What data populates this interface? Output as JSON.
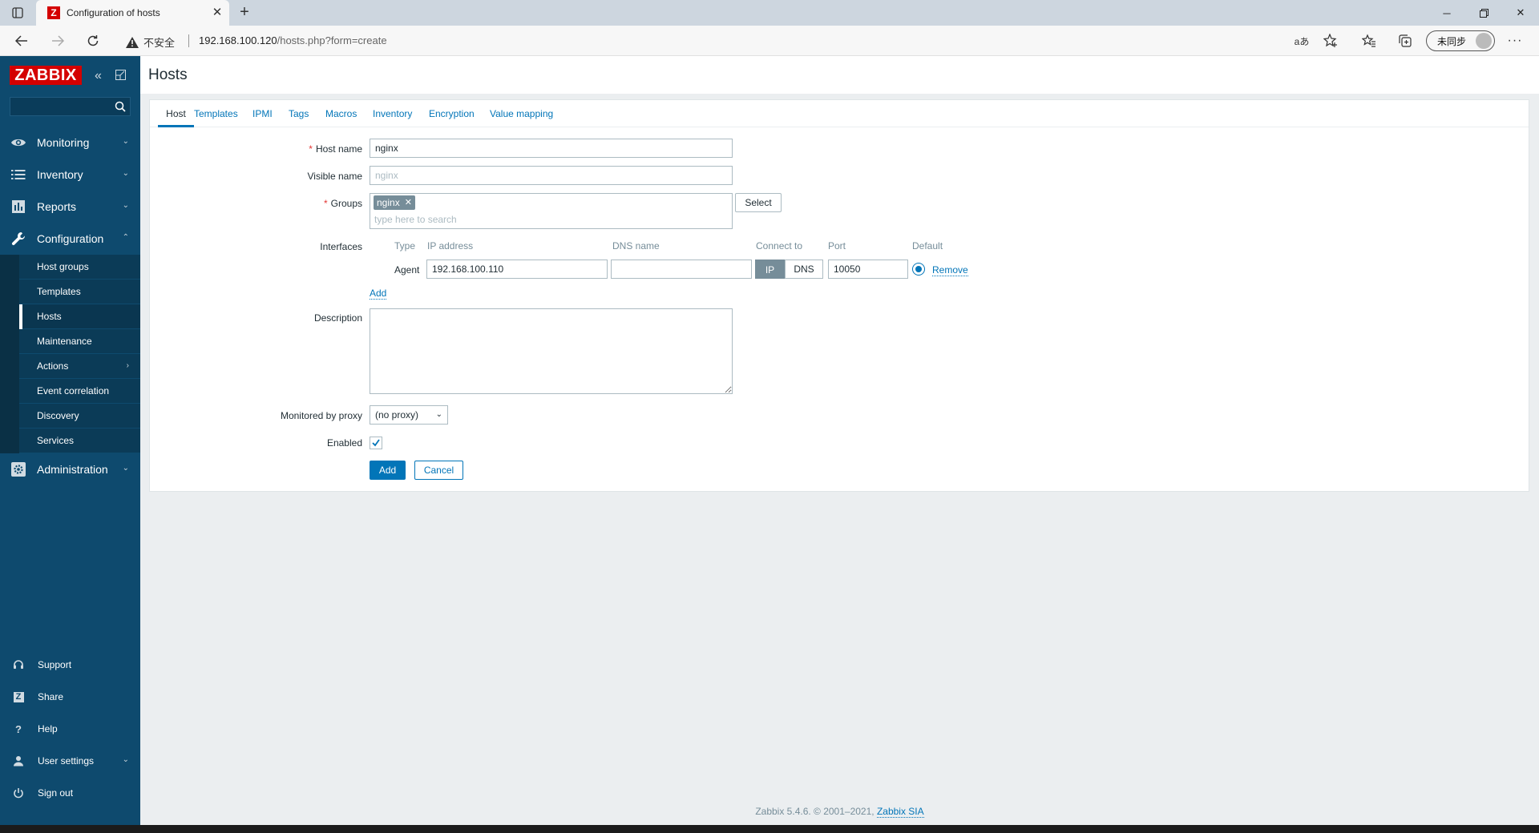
{
  "browser": {
    "tab_title": "Configuration of hosts",
    "tab_favicon": "Z",
    "security_label": "不安全",
    "url_host": "192.168.100.120",
    "url_path": "/hosts.php?form=create",
    "translate_label": "aあ",
    "profile_label": "未同步"
  },
  "sidebar": {
    "logo": "ZABBIX",
    "menu": [
      {
        "label": "Monitoring",
        "icon": "eye-icon"
      },
      {
        "label": "Inventory",
        "icon": "list-icon"
      },
      {
        "label": "Reports",
        "icon": "bar-chart-icon"
      },
      {
        "label": "Configuration",
        "icon": "wrench-icon"
      }
    ],
    "submenu": [
      {
        "label": "Host groups"
      },
      {
        "label": "Templates"
      },
      {
        "label": "Hosts"
      },
      {
        "label": "Maintenance"
      },
      {
        "label": "Actions"
      },
      {
        "label": "Event correlation"
      },
      {
        "label": "Discovery"
      },
      {
        "label": "Services"
      }
    ],
    "admin": {
      "label": "Administration",
      "icon": "gear-icon"
    },
    "bottom": [
      {
        "label": "Support",
        "icon": "headset-icon"
      },
      {
        "label": "Share",
        "icon": "share-icon",
        "glyph": "Z"
      },
      {
        "label": "Help",
        "icon": "help-icon",
        "glyph": "?"
      },
      {
        "label": "User settings",
        "icon": "user-icon"
      },
      {
        "label": "Sign out",
        "icon": "power-icon"
      }
    ]
  },
  "page": {
    "title": "Hosts"
  },
  "tabs": [
    "Host",
    "Templates",
    "IPMI",
    "Tags",
    "Macros",
    "Inventory",
    "Encryption",
    "Value mapping"
  ],
  "form": {
    "host_name": {
      "label": "Host name",
      "required": "*",
      "value": "nginx"
    },
    "visible_name": {
      "label": "Visible name",
      "placeholder": "nginx"
    },
    "groups": {
      "label": "Groups",
      "required": "*",
      "tag": "nginx",
      "placeholder": "type here to search",
      "select_label": "Select"
    },
    "interfaces": {
      "label": "Interfaces",
      "columns": [
        "Type",
        "IP address",
        "DNS name",
        "Connect to",
        "Port",
        "Default"
      ],
      "row": {
        "type": "Agent",
        "ip": "192.168.100.110",
        "dns": "",
        "connect_ip": "IP",
        "connect_dns": "DNS",
        "port": "10050",
        "remove": "Remove"
      },
      "add_label": "Add"
    },
    "description": {
      "label": "Description",
      "value": ""
    },
    "proxy": {
      "label": "Monitored by proxy",
      "value": "(no proxy)"
    },
    "enabled": {
      "label": "Enabled",
      "checked": true
    },
    "add_button": "Add",
    "cancel_button": "Cancel"
  },
  "footer": {
    "text": "Zabbix 5.4.6. © 2001–2021, ",
    "link": "Zabbix SIA"
  },
  "colors": {
    "brand": "#d40000",
    "sidebar": "#0e4a6e",
    "link": "#0275b8",
    "primary": "#0275b8"
  }
}
